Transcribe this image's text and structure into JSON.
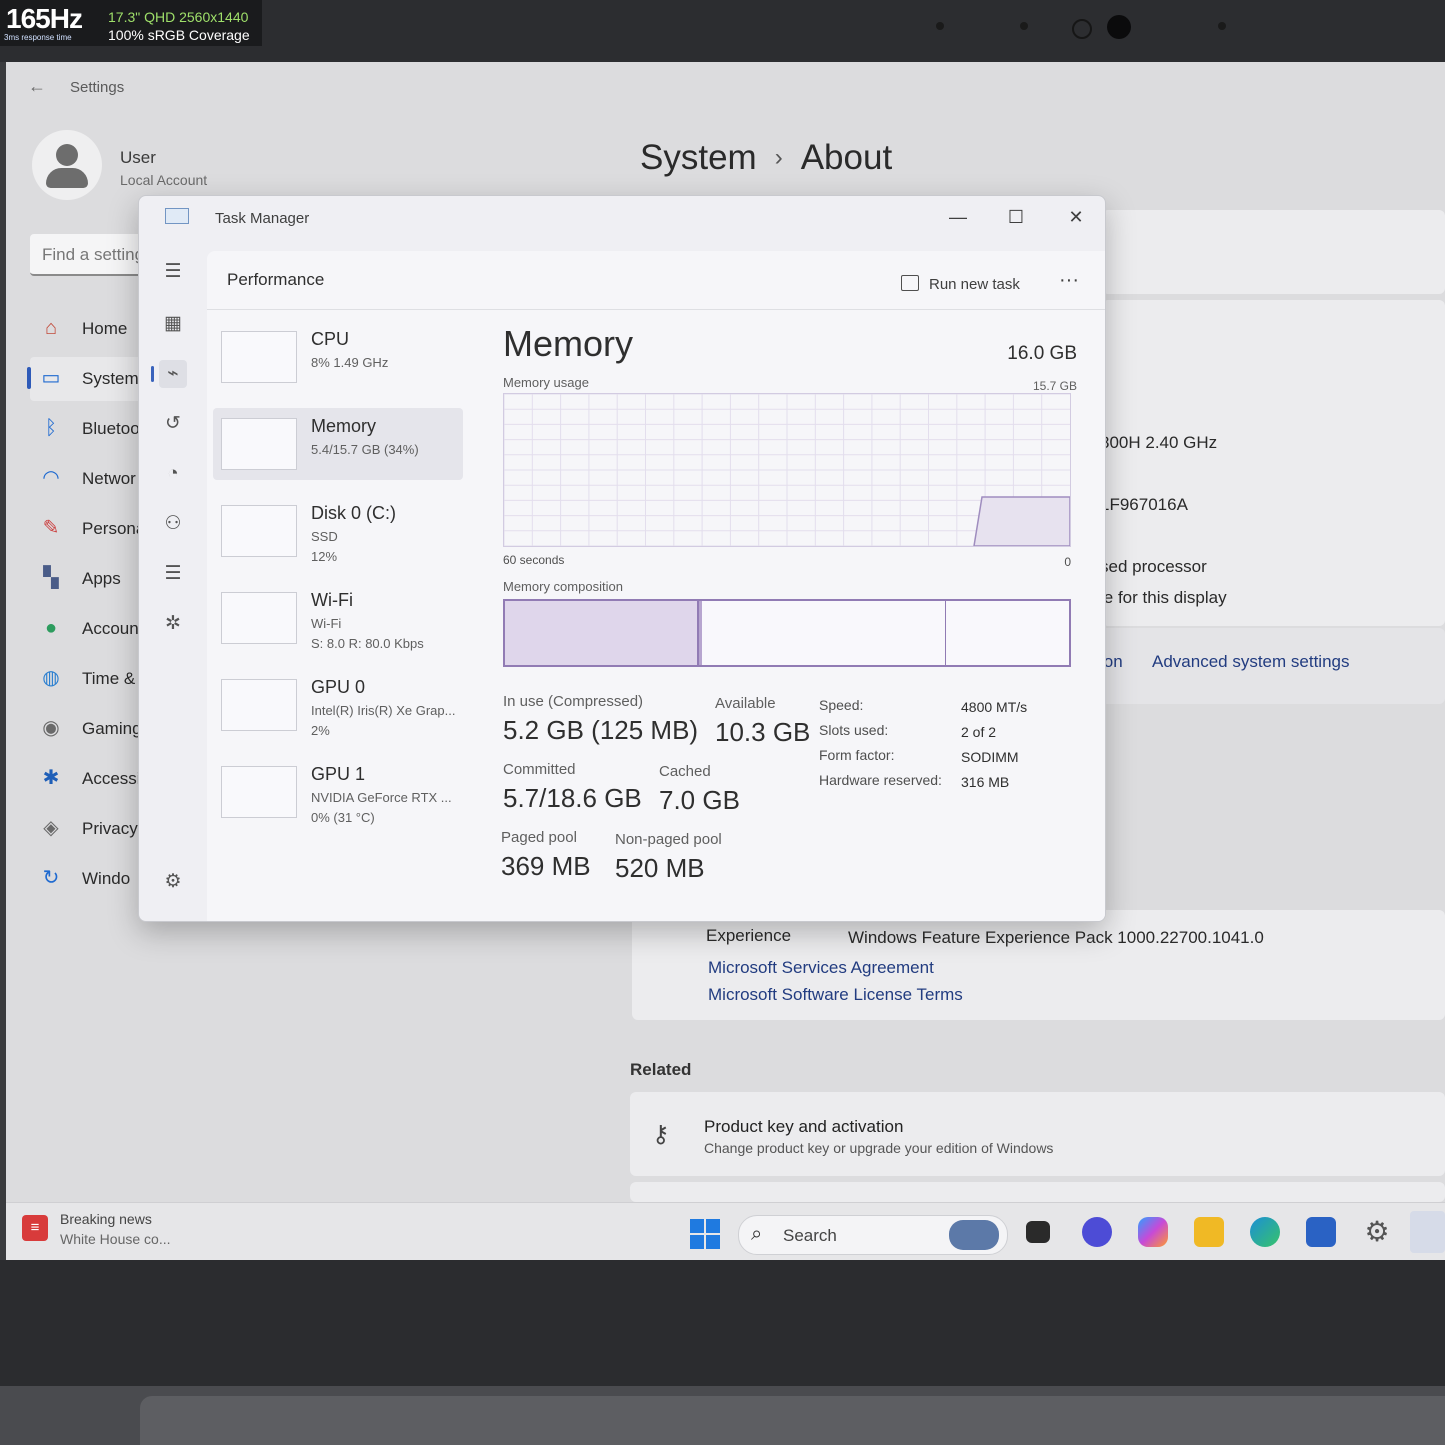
{
  "sticker": {
    "hz": "165Hz",
    "response": "3ms response time",
    "spec1": "17.3\" QHD 2560x1440",
    "spec2": "100% sRGB Coverage"
  },
  "settings": {
    "title": "Settings",
    "user_name": "User",
    "user_type": "Local Account",
    "search_placeholder": "Find a setting",
    "nav": [
      {
        "label": "Home",
        "icon": "home-icon"
      },
      {
        "label": "System",
        "icon": "monitor-icon"
      },
      {
        "label": "Bluetoo",
        "icon": "bluetooth-icon"
      },
      {
        "label": "Networ",
        "icon": "wifi-icon"
      },
      {
        "label": "Persona",
        "icon": "brush-icon"
      },
      {
        "label": "Apps",
        "icon": "apps-icon"
      },
      {
        "label": "Accoun",
        "icon": "person-icon"
      },
      {
        "label": "Time &",
        "icon": "globe-icon"
      },
      {
        "label": "Gaming",
        "icon": "gamepad-icon"
      },
      {
        "label": "Accessi",
        "icon": "accessibility-icon"
      },
      {
        "label": "Privacy",
        "icon": "shield-icon"
      },
      {
        "label": "Windo",
        "icon": "update-icon"
      }
    ],
    "breadcrumb": {
      "parent": "System",
      "sep": "›",
      "current": "About"
    },
    "device_specs": {
      "processor": "800H   2.40 GHz",
      "product_id": "1F967016A",
      "system_type": "sed processor",
      "pen_touch": "le for this display"
    },
    "related_links_partial": "ion",
    "advanced_link": "Advanced system settings",
    "experience_label": "Experience",
    "experience_value": "Windows Feature Experience Pack 1000.22700.1041.0",
    "links": [
      "Microsoft Services Agreement",
      "Microsoft Software License Terms"
    ],
    "related_heading": "Related",
    "product_key": {
      "title": "Product key and activation",
      "subtitle": "Change product key or upgrade your edition of Windows"
    }
  },
  "taskbar": {
    "news_title": "Breaking news",
    "news_sub": "White House co...",
    "search_label": "Search",
    "apps": [
      "task-view-icon",
      "chat-icon",
      "copilot-icon",
      "file-explorer-icon",
      "edge-icon",
      "store-icon",
      "settings-icon",
      "task-manager-icon"
    ]
  },
  "task_manager": {
    "title": "Task Manager",
    "page_title": "Performance",
    "run_new_task": "Run new task",
    "more": "···",
    "resources": [
      {
        "name": "CPU",
        "line1": "8%  1.49 GHz",
        "line2": ""
      },
      {
        "name": "Memory",
        "line1": "5.4/15.7 GB (34%)",
        "line2": ""
      },
      {
        "name": "Disk 0 (C:)",
        "line1": "SSD",
        "line2": "12%"
      },
      {
        "name": "Wi-Fi",
        "line1": "Wi-Fi",
        "line2": "S: 8.0  R: 80.0 Kbps"
      },
      {
        "name": "GPU 0",
        "line1": "Intel(R) Iris(R) Xe Grap...",
        "line2": "2%"
      },
      {
        "name": "GPU 1",
        "line1": "NVIDIA GeForce RTX ...",
        "line2": "0% (31 °C)"
      }
    ],
    "memory": {
      "title": "Memory",
      "total": "16.0 GB",
      "usage_label": "Memory usage",
      "usage_max": "15.7 GB",
      "graph_left": "60 seconds",
      "graph_right": "0",
      "composition_label": "Memory composition",
      "composition": {
        "in_use_fraction": 0.34,
        "modified_fraction": 0.01,
        "standby_fraction": 0.43,
        "free_fraction": 0.22
      },
      "in_use_label": "In use (Compressed)",
      "in_use_value": "5.2 GB (125 MB)",
      "available_label": "Available",
      "available_value": "10.3 GB",
      "committed_label": "Committed",
      "committed_value": "5.7/18.6 GB",
      "cached_label": "Cached",
      "cached_value": "7.0 GB",
      "paged_label": "Paged pool",
      "paged_value": "369 MB",
      "nonpaged_label": "Non-paged pool",
      "nonpaged_value": "520 MB",
      "specs": [
        {
          "k": "Speed:",
          "v": "4800 MT/s"
        },
        {
          "k": "Slots used:",
          "v": "2 of 2"
        },
        {
          "k": "Form factor:",
          "v": "SODIMM"
        },
        {
          "k": "Hardware reserved:",
          "v": "316 MB"
        }
      ]
    }
  }
}
